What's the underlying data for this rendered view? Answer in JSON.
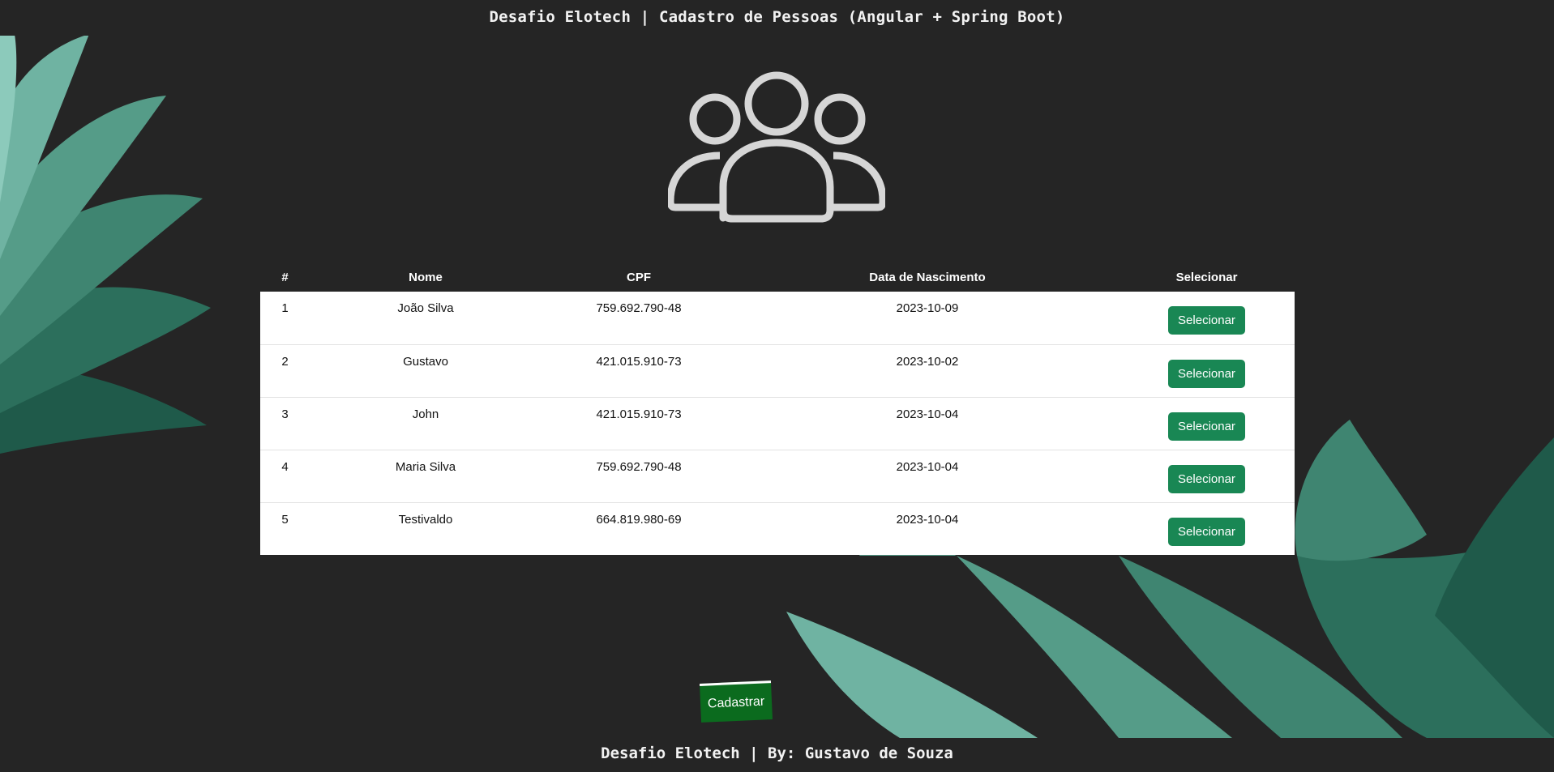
{
  "header": {
    "title": "Desafio Elotech | Cadastro de Pessoas (Angular + Spring Boot)"
  },
  "table": {
    "columns": [
      "#",
      "Nome",
      "CPF",
      "Data de Nascimento",
      "Selecionar"
    ],
    "rows": [
      {
        "id": "1",
        "nome": "João Silva",
        "cpf": "759.692.790-48",
        "nascimento": "2023-10-09",
        "action": "Selecionar"
      },
      {
        "id": "2",
        "nome": "Gustavo",
        "cpf": "421.015.910-73",
        "nascimento": "2023-10-02",
        "action": "Selecionar"
      },
      {
        "id": "3",
        "nome": "John",
        "cpf": "421.015.910-73",
        "nascimento": "2023-10-04",
        "action": "Selecionar"
      },
      {
        "id": "4",
        "nome": "Maria Silva",
        "cpf": "759.692.790-48",
        "nascimento": "2023-10-04",
        "action": "Selecionar"
      },
      {
        "id": "5",
        "nome": "Testivaldo",
        "cpf": "664.819.980-69",
        "nascimento": "2023-10-04",
        "action": "Selecionar"
      }
    ]
  },
  "actions": {
    "cadastrar_label": "Cadastrar"
  },
  "footer": {
    "text": "Desafio Elotech | By: Gustavo de Souza"
  },
  "icons": {
    "hero": "people-group-icon"
  },
  "colors": {
    "background": "#252525",
    "button_green": "#198754",
    "cadastrar_green": "#0b6b1e",
    "leaf_light": "#6fb3a2",
    "leaf_dark": "#1f5a4a"
  }
}
